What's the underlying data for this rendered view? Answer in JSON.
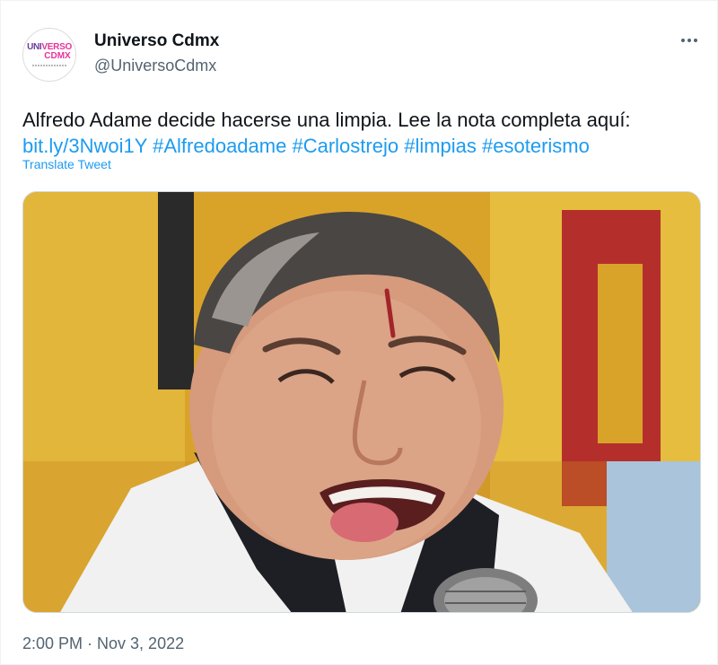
{
  "user": {
    "display_name": "Universo Cdmx",
    "handle": "@UniversoCdmx",
    "avatar": {
      "logo_part1": "UNI",
      "logo_part2": "VERSO",
      "logo_part3": "CDMX",
      "colors": {
        "purple": "#6a3b9c",
        "pink": "#e6339a"
      }
    }
  },
  "menu_icon": "more-horizontal-icon",
  "tweet": {
    "text": "Alfredo Adame decide hacerse una limpia. Lee la nota completa aquí:",
    "link": "bit.ly/3Nwoi1Y",
    "hashtags": [
      "#Alfredoadame",
      "#Carlostrejo",
      "#limpias",
      "#esoterismo"
    ],
    "translate_label": "Translate Tweet",
    "timestamp": "2:00 PM · Nov 3, 2022"
  },
  "colors": {
    "link": "#1d9bf0",
    "text": "#0f1419",
    "secondary": "#536471"
  }
}
